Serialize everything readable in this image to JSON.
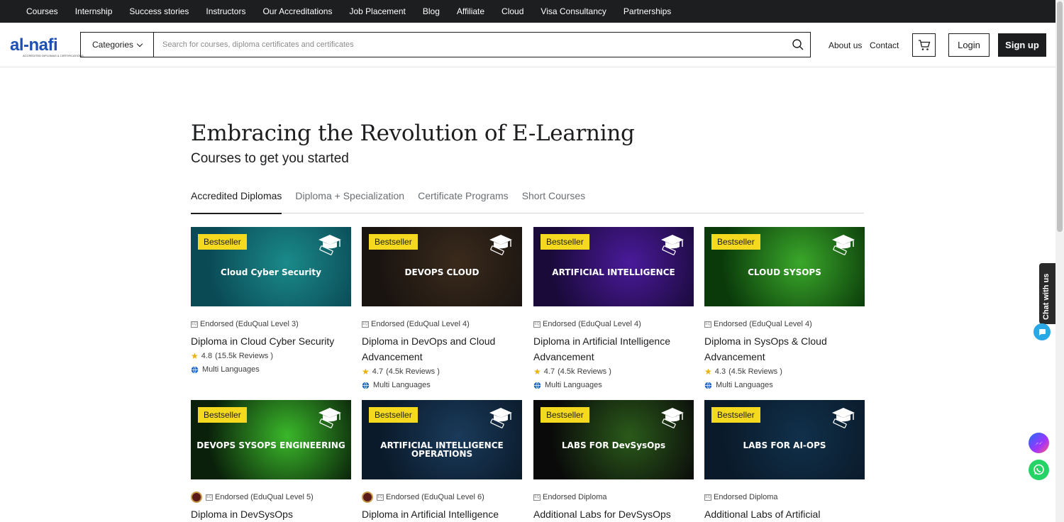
{
  "topnav": [
    "Courses",
    "Internship",
    "Success stories",
    "Instructors",
    "Our Accreditations",
    "Job Placement",
    "Blog",
    "Affiliate",
    "Cloud",
    "Visa Consultancy",
    "Partnerships"
  ],
  "header": {
    "logo": "al-nafi",
    "logo_sub": "ACCREDITED DIPLOMAS & CERTIFICATIONS",
    "categories_label": "Categories",
    "search_placeholder": "Search for courses, diploma certificates and certificates",
    "about": "About us",
    "contact": "Contact",
    "login": "Login",
    "signup": "Sign up"
  },
  "hero": {
    "title": "Embracing the Revolution of E-Learning",
    "subtitle": "Courses to get you started"
  },
  "tabs": [
    "Accredited Diplomas",
    "Diploma + Specialization",
    "Certificate Programs",
    "Short Courses"
  ],
  "badge_label": "Bestseller",
  "cards": [
    {
      "thumb_text": "Cloud Cyber Security",
      "endorsed": "Endorsed (EduQual Level 3)",
      "title": "Diploma in Cloud Cyber Security",
      "rating": "4.8",
      "reviews": "(15.5k Reviews )",
      "langs": "Multi Languages",
      "colors": [
        "#0a4a55",
        "#1a8a8a"
      ]
    },
    {
      "thumb_text": "DEVOPS CLOUD",
      "endorsed": "Endorsed (EduQual Level 4)",
      "title": "Diploma in DevOps and Cloud Advancement",
      "rating": "4.7",
      "reviews": "(4.5k Reviews )",
      "langs": "Multi Languages",
      "colors": [
        "#1a1410",
        "#3a2a1c"
      ]
    },
    {
      "thumb_text": "ARTIFICIAL INTELLIGENCE",
      "endorsed": "Endorsed (EduQual Level 4)",
      "title": "Diploma in Artificial Intelligence Advancement",
      "rating": "4.7",
      "reviews": "(4.5k Reviews )",
      "langs": "Multi Languages",
      "colors": [
        "#1a0a3a",
        "#4a1a9a"
      ]
    },
    {
      "thumb_text": "CLOUD SYSOPS",
      "endorsed": "Endorsed (EduQual Level 4)",
      "title": "Diploma in SysOps & Cloud Advancement",
      "rating": "4.3",
      "reviews": "(4.5k Reviews )",
      "langs": "Multi Languages",
      "colors": [
        "#0a3a0a",
        "#3aa82a"
      ]
    },
    {
      "thumb_text": "DEVOPS SYSOPS ENGINEERING",
      "endorsed": "Endorsed (EduQual Level 5)",
      "title": "Diploma in DevSysOps",
      "colors": [
        "#0a200a",
        "#3ab82a"
      ],
      "seal": true
    },
    {
      "thumb_text": "ARTIFICIAL INTELLIGENCE OPERATIONS",
      "endorsed": "Endorsed (EduQual Level 6)",
      "title": "Diploma in Artificial Intelligence",
      "colors": [
        "#0a1a2a",
        "#1a3a5a"
      ],
      "seal": true
    },
    {
      "thumb_text": "LABS FOR DevSysOps",
      "endorsed": "Endorsed Diploma",
      "title": "Additional Labs for DevSysOps",
      "colors": [
        "#0a0a0a",
        "#2a5a1a"
      ]
    },
    {
      "thumb_text": "LABS FOR AI-OPS",
      "endorsed": "Endorsed Diploma",
      "title": "Additional Labs of Artificial",
      "colors": [
        "#0a1a2a",
        "#10304a"
      ]
    }
  ],
  "chat": {
    "label": "Chat with us"
  },
  "icon_names": [
    "search-icon",
    "cart-icon",
    "star-icon",
    "globe-icon",
    "graduation-cap-icon",
    "chat-icon",
    "messenger-icon",
    "whatsapp-icon"
  ]
}
